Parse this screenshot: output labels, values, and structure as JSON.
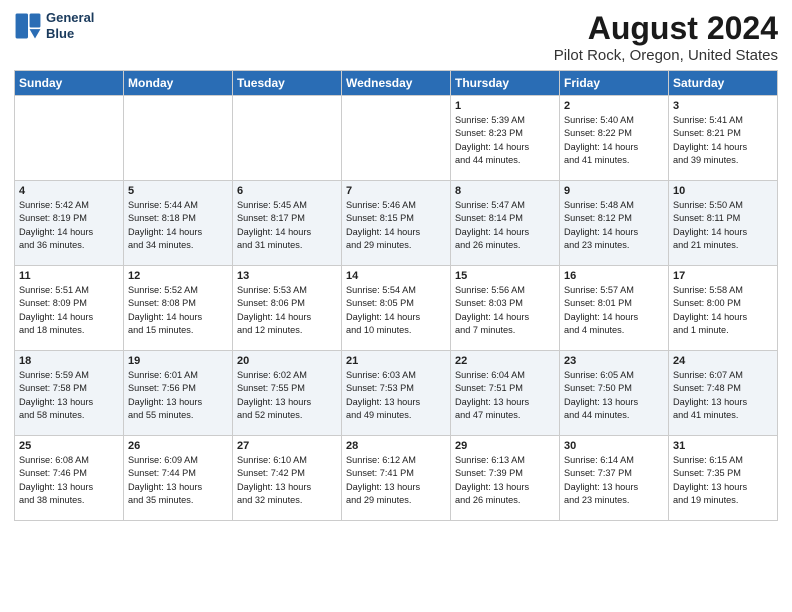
{
  "logo": {
    "line1": "General",
    "line2": "Blue"
  },
  "title": "August 2024",
  "subtitle": "Pilot Rock, Oregon, United States",
  "weekdays": [
    "Sunday",
    "Monday",
    "Tuesday",
    "Wednesday",
    "Thursday",
    "Friday",
    "Saturday"
  ],
  "weeks": [
    [
      {
        "day": "",
        "info": ""
      },
      {
        "day": "",
        "info": ""
      },
      {
        "day": "",
        "info": ""
      },
      {
        "day": "",
        "info": ""
      },
      {
        "day": "1",
        "info": "Sunrise: 5:39 AM\nSunset: 8:23 PM\nDaylight: 14 hours\nand 44 minutes."
      },
      {
        "day": "2",
        "info": "Sunrise: 5:40 AM\nSunset: 8:22 PM\nDaylight: 14 hours\nand 41 minutes."
      },
      {
        "day": "3",
        "info": "Sunrise: 5:41 AM\nSunset: 8:21 PM\nDaylight: 14 hours\nand 39 minutes."
      }
    ],
    [
      {
        "day": "4",
        "info": "Sunrise: 5:42 AM\nSunset: 8:19 PM\nDaylight: 14 hours\nand 36 minutes."
      },
      {
        "day": "5",
        "info": "Sunrise: 5:44 AM\nSunset: 8:18 PM\nDaylight: 14 hours\nand 34 minutes."
      },
      {
        "day": "6",
        "info": "Sunrise: 5:45 AM\nSunset: 8:17 PM\nDaylight: 14 hours\nand 31 minutes."
      },
      {
        "day": "7",
        "info": "Sunrise: 5:46 AM\nSunset: 8:15 PM\nDaylight: 14 hours\nand 29 minutes."
      },
      {
        "day": "8",
        "info": "Sunrise: 5:47 AM\nSunset: 8:14 PM\nDaylight: 14 hours\nand 26 minutes."
      },
      {
        "day": "9",
        "info": "Sunrise: 5:48 AM\nSunset: 8:12 PM\nDaylight: 14 hours\nand 23 minutes."
      },
      {
        "day": "10",
        "info": "Sunrise: 5:50 AM\nSunset: 8:11 PM\nDaylight: 14 hours\nand 21 minutes."
      }
    ],
    [
      {
        "day": "11",
        "info": "Sunrise: 5:51 AM\nSunset: 8:09 PM\nDaylight: 14 hours\nand 18 minutes."
      },
      {
        "day": "12",
        "info": "Sunrise: 5:52 AM\nSunset: 8:08 PM\nDaylight: 14 hours\nand 15 minutes."
      },
      {
        "day": "13",
        "info": "Sunrise: 5:53 AM\nSunset: 8:06 PM\nDaylight: 14 hours\nand 12 minutes."
      },
      {
        "day": "14",
        "info": "Sunrise: 5:54 AM\nSunset: 8:05 PM\nDaylight: 14 hours\nand 10 minutes."
      },
      {
        "day": "15",
        "info": "Sunrise: 5:56 AM\nSunset: 8:03 PM\nDaylight: 14 hours\nand 7 minutes."
      },
      {
        "day": "16",
        "info": "Sunrise: 5:57 AM\nSunset: 8:01 PM\nDaylight: 14 hours\nand 4 minutes."
      },
      {
        "day": "17",
        "info": "Sunrise: 5:58 AM\nSunset: 8:00 PM\nDaylight: 14 hours\nand 1 minute."
      }
    ],
    [
      {
        "day": "18",
        "info": "Sunrise: 5:59 AM\nSunset: 7:58 PM\nDaylight: 13 hours\nand 58 minutes."
      },
      {
        "day": "19",
        "info": "Sunrise: 6:01 AM\nSunset: 7:56 PM\nDaylight: 13 hours\nand 55 minutes."
      },
      {
        "day": "20",
        "info": "Sunrise: 6:02 AM\nSunset: 7:55 PM\nDaylight: 13 hours\nand 52 minutes."
      },
      {
        "day": "21",
        "info": "Sunrise: 6:03 AM\nSunset: 7:53 PM\nDaylight: 13 hours\nand 49 minutes."
      },
      {
        "day": "22",
        "info": "Sunrise: 6:04 AM\nSunset: 7:51 PM\nDaylight: 13 hours\nand 47 minutes."
      },
      {
        "day": "23",
        "info": "Sunrise: 6:05 AM\nSunset: 7:50 PM\nDaylight: 13 hours\nand 44 minutes."
      },
      {
        "day": "24",
        "info": "Sunrise: 6:07 AM\nSunset: 7:48 PM\nDaylight: 13 hours\nand 41 minutes."
      }
    ],
    [
      {
        "day": "25",
        "info": "Sunrise: 6:08 AM\nSunset: 7:46 PM\nDaylight: 13 hours\nand 38 minutes."
      },
      {
        "day": "26",
        "info": "Sunrise: 6:09 AM\nSunset: 7:44 PM\nDaylight: 13 hours\nand 35 minutes."
      },
      {
        "day": "27",
        "info": "Sunrise: 6:10 AM\nSunset: 7:42 PM\nDaylight: 13 hours\nand 32 minutes."
      },
      {
        "day": "28",
        "info": "Sunrise: 6:12 AM\nSunset: 7:41 PM\nDaylight: 13 hours\nand 29 minutes."
      },
      {
        "day": "29",
        "info": "Sunrise: 6:13 AM\nSunset: 7:39 PM\nDaylight: 13 hours\nand 26 minutes."
      },
      {
        "day": "30",
        "info": "Sunrise: 6:14 AM\nSunset: 7:37 PM\nDaylight: 13 hours\nand 23 minutes."
      },
      {
        "day": "31",
        "info": "Sunrise: 6:15 AM\nSunset: 7:35 PM\nDaylight: 13 hours\nand 19 minutes."
      }
    ]
  ]
}
